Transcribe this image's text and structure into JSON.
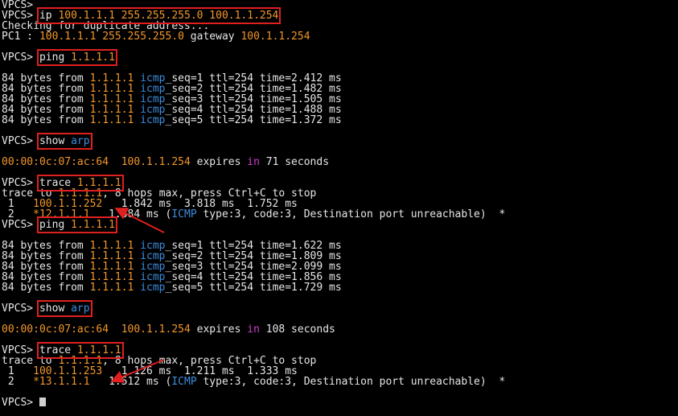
{
  "terminal": {
    "prompt": "VPCS>",
    "lines": [
      {
        "type": "prompt"
      },
      {
        "type": "cmd",
        "parts": [
          {
            "t": "ip "
          },
          {
            "t": "100.1.1.1 255.255.255.0 100.1.1.254",
            "c": "o"
          }
        ]
      },
      {
        "type": "text",
        "parts": [
          {
            "t": "Checking for duplicate address..."
          }
        ]
      },
      {
        "type": "text",
        "parts": [
          {
            "t": "PC1 : "
          },
          {
            "t": "100.1.1.1 255.255.255.0",
            "c": "o"
          },
          {
            "t": " gateway "
          },
          {
            "t": "100.1.1.254",
            "c": "o"
          }
        ]
      },
      {
        "type": "blank"
      },
      {
        "type": "cmd",
        "parts": [
          {
            "t": "ping "
          },
          {
            "t": "1.1.1.1",
            "c": "o"
          }
        ]
      },
      {
        "type": "blank"
      },
      {
        "type": "text",
        "parts": [
          {
            "t": "84 bytes from "
          },
          {
            "t": "1.1.1.1",
            "c": "o"
          },
          {
            "t": " "
          },
          {
            "t": "icmp",
            "c": "b"
          },
          {
            "t": "_seq=1 ttl=254 time=2.412 ms"
          }
        ]
      },
      {
        "type": "text",
        "parts": [
          {
            "t": "84 bytes from "
          },
          {
            "t": "1.1.1.1",
            "c": "o"
          },
          {
            "t": " "
          },
          {
            "t": "icmp",
            "c": "b"
          },
          {
            "t": "_seq=2 ttl=254 time=1.482 ms"
          }
        ]
      },
      {
        "type": "text",
        "parts": [
          {
            "t": "84 bytes from "
          },
          {
            "t": "1.1.1.1",
            "c": "o"
          },
          {
            "t": " "
          },
          {
            "t": "icmp",
            "c": "b"
          },
          {
            "t": "_seq=3 ttl=254 time=1.505 ms"
          }
        ]
      },
      {
        "type": "text",
        "parts": [
          {
            "t": "84 bytes from "
          },
          {
            "t": "1.1.1.1",
            "c": "o"
          },
          {
            "t": " "
          },
          {
            "t": "icmp",
            "c": "b"
          },
          {
            "t": "_seq=4 ttl=254 time=1.488 ms"
          }
        ]
      },
      {
        "type": "text",
        "parts": [
          {
            "t": "84 bytes from "
          },
          {
            "t": "1.1.1.1",
            "c": "o"
          },
          {
            "t": " "
          },
          {
            "t": "icmp",
            "c": "b"
          },
          {
            "t": "_seq=5 ttl=254 time=1.372 ms"
          }
        ]
      },
      {
        "type": "blank"
      },
      {
        "type": "cmd",
        "parts": [
          {
            "t": "show "
          },
          {
            "t": "arp",
            "c": "b"
          }
        ]
      },
      {
        "type": "blank"
      },
      {
        "type": "text",
        "parts": [
          {
            "t": "00:00:0c:07:ac:64",
            "c": "o"
          },
          {
            "t": "  "
          },
          {
            "t": "100.1.1.254",
            "c": "o"
          },
          {
            "t": " expires "
          },
          {
            "t": "in",
            "c": "m"
          },
          {
            "t": " 71 seconds"
          }
        ]
      },
      {
        "type": "blank"
      },
      {
        "type": "cmd",
        "parts": [
          {
            "t": "trace "
          },
          {
            "t": "1.1.1.1",
            "c": "o"
          }
        ]
      },
      {
        "type": "text",
        "parts": [
          {
            "t": "trace to "
          },
          {
            "t": "1.1.1.1",
            "c": "o"
          },
          {
            "t": ", 8 hops max, press Ctrl+C to stop"
          }
        ]
      },
      {
        "type": "text",
        "parts": [
          {
            "t": " 1   "
          },
          {
            "t": "100.1.1.252",
            "c": "o"
          },
          {
            "t": "   1.842 ms  3.818 ms  1.752 ms"
          }
        ]
      },
      {
        "type": "text",
        "parts": [
          {
            "t": " 2   "
          },
          {
            "t": "*12.1.1.1",
            "c": "o"
          },
          {
            "t": "   1.384 ms ("
          },
          {
            "t": "ICMP",
            "c": "b"
          },
          {
            "t": " type:3, code:3, Destination port unreachable)  *"
          }
        ]
      },
      {
        "type": "cmd",
        "parts": [
          {
            "t": "ping "
          },
          {
            "t": "1.1.1.1",
            "c": "o"
          }
        ]
      },
      {
        "type": "blank"
      },
      {
        "type": "text",
        "parts": [
          {
            "t": "84 bytes from "
          },
          {
            "t": "1.1.1.1",
            "c": "o"
          },
          {
            "t": " "
          },
          {
            "t": "icmp",
            "c": "b"
          },
          {
            "t": "_seq=1 ttl=254 time=1.622 ms"
          }
        ]
      },
      {
        "type": "text",
        "parts": [
          {
            "t": "84 bytes from "
          },
          {
            "t": "1.1.1.1",
            "c": "o"
          },
          {
            "t": " "
          },
          {
            "t": "icmp",
            "c": "b"
          },
          {
            "t": "_seq=2 ttl=254 time=1.809 ms"
          }
        ]
      },
      {
        "type": "text",
        "parts": [
          {
            "t": "84 bytes from "
          },
          {
            "t": "1.1.1.1",
            "c": "o"
          },
          {
            "t": " "
          },
          {
            "t": "icmp",
            "c": "b"
          },
          {
            "t": "_seq=3 ttl=254 time=2.099 ms"
          }
        ]
      },
      {
        "type": "text",
        "parts": [
          {
            "t": "84 bytes from "
          },
          {
            "t": "1.1.1.1",
            "c": "o"
          },
          {
            "t": " "
          },
          {
            "t": "icmp",
            "c": "b"
          },
          {
            "t": "_seq=4 ttl=254 time=1.856 ms"
          }
        ]
      },
      {
        "type": "text",
        "parts": [
          {
            "t": "84 bytes from "
          },
          {
            "t": "1.1.1.1",
            "c": "o"
          },
          {
            "t": " "
          },
          {
            "t": "icmp",
            "c": "b"
          },
          {
            "t": "_seq=5 ttl=254 time=1.729 ms"
          }
        ]
      },
      {
        "type": "blank"
      },
      {
        "type": "cmd",
        "parts": [
          {
            "t": "show "
          },
          {
            "t": "arp",
            "c": "b"
          }
        ]
      },
      {
        "type": "blank"
      },
      {
        "type": "text",
        "parts": [
          {
            "t": "00:00:0c:07:ac:64",
            "c": "o"
          },
          {
            "t": "  "
          },
          {
            "t": "100.1.1.254",
            "c": "o"
          },
          {
            "t": " expires "
          },
          {
            "t": "in",
            "c": "m"
          },
          {
            "t": " 108 seconds"
          }
        ]
      },
      {
        "type": "blank"
      },
      {
        "type": "cmd",
        "parts": [
          {
            "t": "trace "
          },
          {
            "t": "1.1.1.1",
            "c": "o"
          }
        ]
      },
      {
        "type": "text",
        "parts": [
          {
            "t": "trace to "
          },
          {
            "t": "1.1.1.1",
            "c": "o"
          },
          {
            "t": ", 8 hops max, press Ctrl+C to stop"
          }
        ]
      },
      {
        "type": "text",
        "parts": [
          {
            "t": " 1   "
          },
          {
            "t": "100.1.1.253",
            "c": "o"
          },
          {
            "t": "   1.126 ms  1.211 ms  1.333 ms"
          }
        ]
      },
      {
        "type": "text",
        "parts": [
          {
            "t": " 2   "
          },
          {
            "t": "*13.1.1.1",
            "c": "o"
          },
          {
            "t": "   1.512 ms ("
          },
          {
            "t": "ICMP",
            "c": "b"
          },
          {
            "t": " type:3, code:3, Destination port unreachable)  *"
          }
        ]
      },
      {
        "type": "blank"
      },
      {
        "type": "input"
      }
    ]
  },
  "colors": {
    "background": "#000000",
    "text": "#e6e6e6",
    "ip_highlight": "#f0962a",
    "keyword": "#3c8cdc",
    "in_keyword": "#d23cd2",
    "annotation": "#e02020"
  }
}
